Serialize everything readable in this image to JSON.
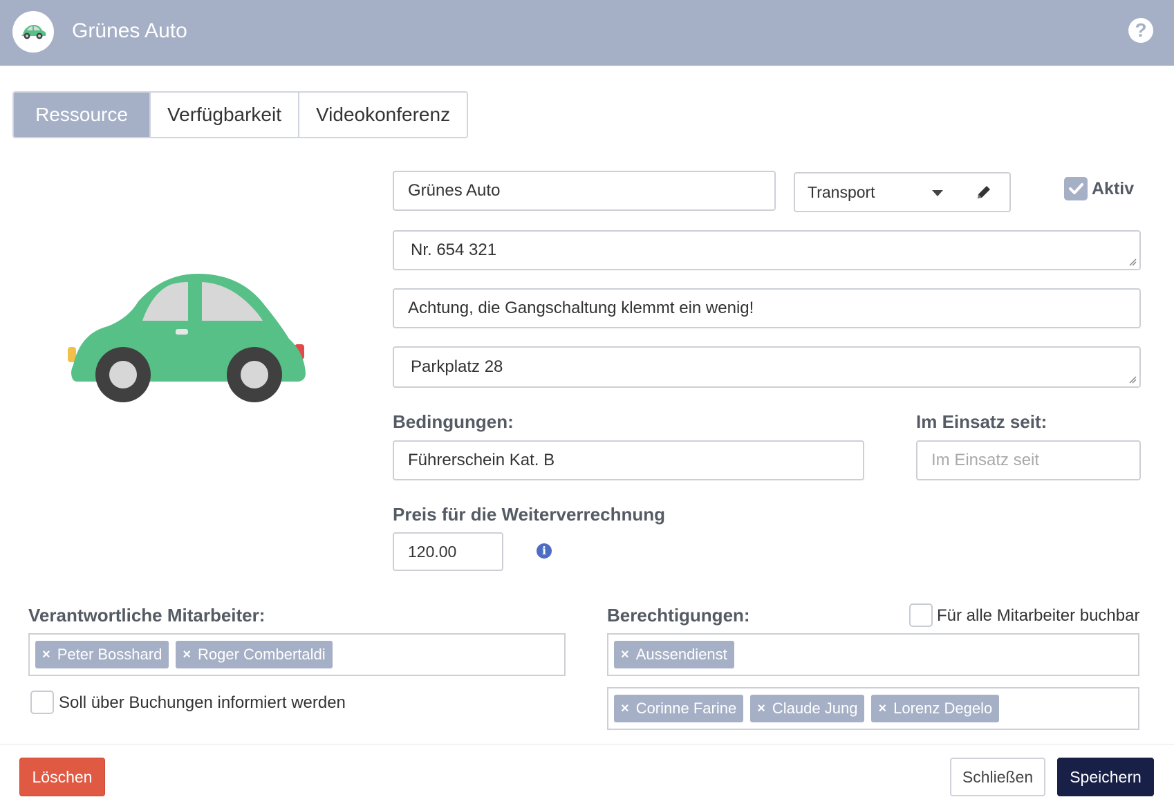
{
  "header": {
    "title": "Grünes Auto",
    "help": "?"
  },
  "tabs": [
    {
      "label": "Ressource",
      "active": true
    },
    {
      "label": "Verfügbarkeit",
      "active": false
    },
    {
      "label": "Videokonferenz",
      "active": false
    }
  ],
  "form": {
    "name": "Grünes Auto",
    "category": "Transport",
    "aktiv_label": "Aktiv",
    "number": "Nr. 654 321",
    "note": "Achtung, die Gangschaltung klemmt ein wenig!",
    "location": "Parkplatz 28",
    "conditions_label": "Bedingungen:",
    "conditions_value": "Führerschein Kat. B",
    "in_use_label": "Im Einsatz seit:",
    "in_use_placeholder": "Im Einsatz seit",
    "price_label": "Preis für die Weiterverrechnung",
    "price_value": "120.00"
  },
  "responsible": {
    "label": "Verantwortliche Mitarbeiter:",
    "tags": [
      "Peter Bosshard",
      "Roger Combertaldi"
    ],
    "notify_label": "Soll über Buchungen informiert werden"
  },
  "permissions": {
    "label": "Berechtigungen:",
    "all_label": "Für alle Mitarbeiter buchbar",
    "groups": [
      "Aussendienst"
    ],
    "people": [
      "Corinne Farine",
      "Claude Jung",
      "Lorenz Degelo"
    ]
  },
  "footer": {
    "delete": "Löschen",
    "close": "Schließen",
    "save": "Speichern"
  },
  "colors": {
    "header": "#a5b0c7",
    "car": "#57c087",
    "delete": "#e05a43",
    "save": "#182048"
  }
}
